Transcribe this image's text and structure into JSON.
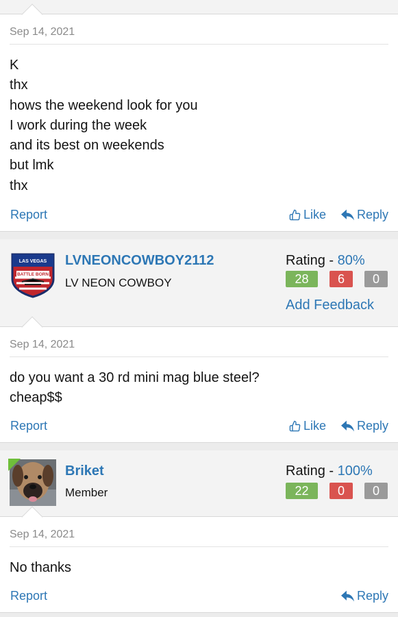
{
  "posts": [
    {
      "date": "Sep 14, 2021",
      "lines": [
        "K",
        "thx",
        "hows the weekend look for you",
        "I work during the week",
        "and its best on weekends",
        "but lmk",
        "thx"
      ],
      "report_label": "Report",
      "like_label": "Like",
      "reply_label": "Reply"
    },
    {
      "date": "Sep 14, 2021",
      "lines": [
        "do you want a 30 rd mini mag blue steel?",
        "cheap$$"
      ],
      "report_label": "Report",
      "like_label": "Like",
      "reply_label": "Reply"
    },
    {
      "date": "Sep 14, 2021",
      "lines": [
        "No thanks"
      ],
      "report_label": "Report",
      "reply_label": "Reply"
    }
  ],
  "authors": [
    {
      "username": "LVNEONCOWBOY2112",
      "title": "LV NEON COWBOY",
      "rating_label": "Rating -",
      "rating_pct": "80%",
      "positive": "28",
      "negative": "6",
      "neutral": "0",
      "feedback_label": "Add Feedback",
      "avatar_text_top": "LAS VEGAS",
      "avatar_text_mid": "BATTLE BORN"
    },
    {
      "username": "Briket",
      "title": "Member",
      "rating_label": "Rating -",
      "rating_pct": "100%",
      "positive": "22",
      "negative": "0",
      "neutral": "0"
    }
  ],
  "colors": {
    "link": "#2d77b5",
    "positive": "#7bb55b",
    "negative": "#d9534f",
    "neutral": "#9a9a9a",
    "online": "#6fbf3a"
  }
}
